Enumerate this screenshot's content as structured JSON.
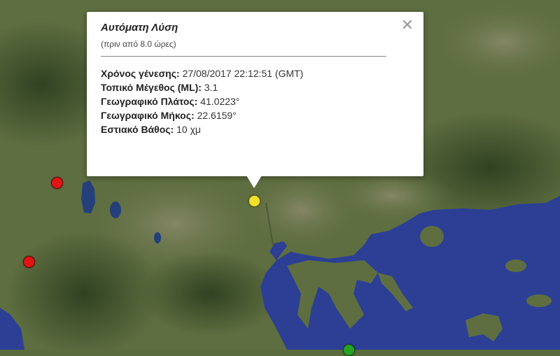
{
  "popup": {
    "title": "Αυτόματη Λύση",
    "subtitle": "(πριν από 8.0 ώρες)",
    "close_icon": "close-icon",
    "rows": [
      {
        "label": "Χρόνος γένεσης:",
        "value": "27/08/2017  22:12:51 (GMT)"
      },
      {
        "label": "Τοπικό Μέγεθος (ML):",
        "value": "3.1"
      },
      {
        "label": "Γεωγραφικό Πλάτος:",
        "value": "41.0223°"
      },
      {
        "label": "Γεωγραφικό Μήκος:",
        "value": "22.6159°"
      },
      {
        "label": "Εστιακό Βάθος:",
        "value": "10 χμ"
      }
    ]
  },
  "markers": [
    {
      "name": "earthquake-marker-selected",
      "color": "#f2e22a"
    },
    {
      "name": "earthquake-marker-red-1",
      "color": "#e01414"
    },
    {
      "name": "earthquake-marker-red-2",
      "color": "#e01414"
    },
    {
      "name": "earthquake-marker-green",
      "color": "#26a324"
    }
  ],
  "colors": {
    "land": "#5e6e40",
    "sea": "#2c3f95",
    "lake": "#243f7a"
  }
}
